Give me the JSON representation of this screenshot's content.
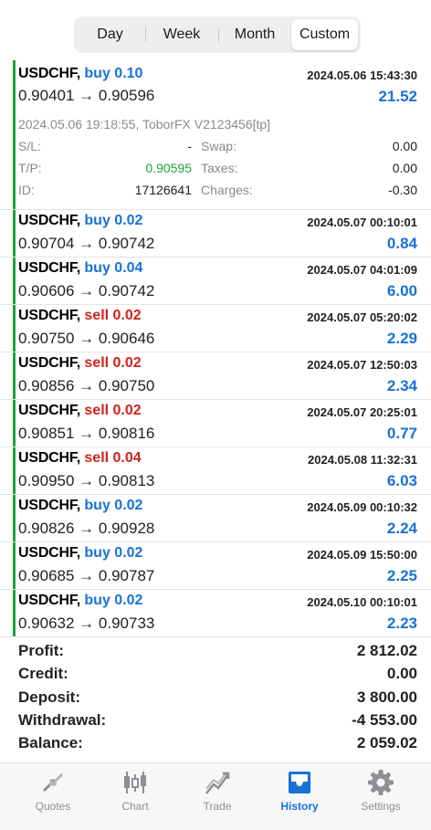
{
  "periods": {
    "tabs": [
      "Day",
      "Week",
      "Month",
      "Custom"
    ],
    "selected": "Custom"
  },
  "colors": {
    "accent": "#1872d6",
    "buy": "#1872d6",
    "sell": "#d0231c",
    "green": "#1fa33a"
  },
  "trades": [
    {
      "symbol": "USDCHF,",
      "side": "buy",
      "volume": "0.10",
      "time": "2024.05.06 15:43:30",
      "prices": "0.90401 → 0.90596",
      "profit": "21.52",
      "expanded": true,
      "details": {
        "meta": "2024.05.06 19:18:55, ToborFX V2123456[tp]",
        "sl_label": "S/L:",
        "sl_value": "-",
        "tp_label": "T/P:",
        "tp_value": "0.90595",
        "id_label": "ID:",
        "id_value": "17126641",
        "swap_label": "Swap:",
        "swap_value": "0.00",
        "taxes_label": "Taxes:",
        "taxes_value": "0.00",
        "charges_label": "Charges:",
        "charges_value": "-0.30"
      }
    },
    {
      "symbol": "USDCHF,",
      "side": "buy",
      "volume": "0.02",
      "time": "2024.05.07 00:10:01",
      "prices": "0.90704 → 0.90742",
      "profit": "0.84"
    },
    {
      "symbol": "USDCHF,",
      "side": "buy",
      "volume": "0.04",
      "time": "2024.05.07 04:01:09",
      "prices": "0.90606 → 0.90742",
      "profit": "6.00"
    },
    {
      "symbol": "USDCHF,",
      "side": "sell",
      "volume": "0.02",
      "time": "2024.05.07 05:20:02",
      "prices": "0.90750 → 0.90646",
      "profit": "2.29"
    },
    {
      "symbol": "USDCHF,",
      "side": "sell",
      "volume": "0.02",
      "time": "2024.05.07 12:50:03",
      "prices": "0.90856 → 0.90750",
      "profit": "2.34"
    },
    {
      "symbol": "USDCHF,",
      "side": "sell",
      "volume": "0.02",
      "time": "2024.05.07 20:25:01",
      "prices": "0.90851 → 0.90816",
      "profit": "0.77"
    },
    {
      "symbol": "USDCHF,",
      "side": "sell",
      "volume": "0.04",
      "time": "2024.05.08 11:32:31",
      "prices": "0.90950 → 0.90813",
      "profit": "6.03"
    },
    {
      "symbol": "USDCHF,",
      "side": "buy",
      "volume": "0.02",
      "time": "2024.05.09 00:10:32",
      "prices": "0.90826 → 0.90928",
      "profit": "2.24"
    },
    {
      "symbol": "USDCHF,",
      "side": "buy",
      "volume": "0.02",
      "time": "2024.05.09 15:50:00",
      "prices": "0.90685 → 0.90787",
      "profit": "2.25"
    },
    {
      "symbol": "USDCHF,",
      "side": "buy",
      "volume": "0.02",
      "time": "2024.05.10 00:10:01",
      "prices": "0.90632 → 0.90733",
      "profit": "2.23"
    }
  ],
  "summary": [
    {
      "label": "Profit:",
      "value": "2 812.02"
    },
    {
      "label": "Credit:",
      "value": "0.00"
    },
    {
      "label": "Deposit:",
      "value": "3 800.00"
    },
    {
      "label": "Withdrawal:",
      "value": "-4 553.00"
    },
    {
      "label": "Balance:",
      "value": "2 059.02"
    }
  ],
  "tabbar": [
    {
      "label": "Quotes",
      "icon": "quotes-icon"
    },
    {
      "label": "Chart",
      "icon": "chart-icon"
    },
    {
      "label": "Trade",
      "icon": "trade-icon"
    },
    {
      "label": "History",
      "icon": "history-icon",
      "active": true
    },
    {
      "label": "Settings",
      "icon": "settings-icon"
    }
  ]
}
